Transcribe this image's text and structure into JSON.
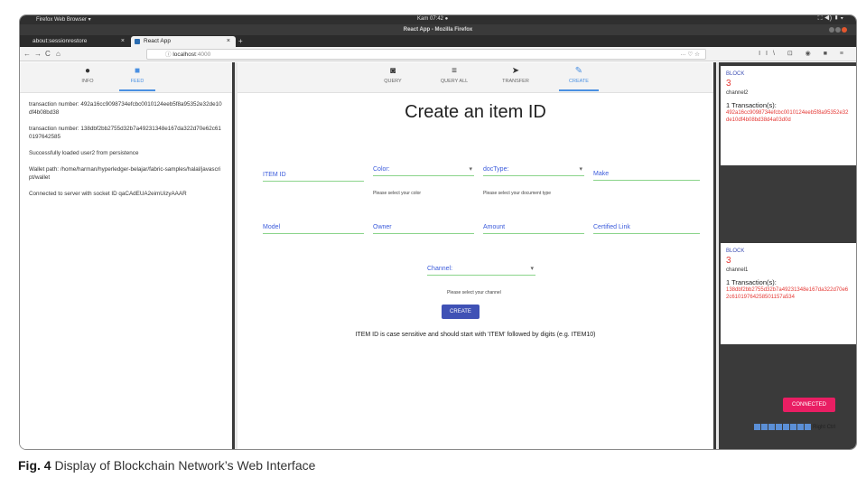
{
  "os": {
    "app_menu": "Firefox Web Browser ▾",
    "clock": "Kam 07:42 ●",
    "tray": "⛶ ◀) ▮ ▾"
  },
  "window": {
    "title": "React App - Mozilla Firefox"
  },
  "tabs": [
    {
      "label": "about:sessionrestore",
      "close": "×"
    },
    {
      "label": "React App",
      "close": "×"
    }
  ],
  "new_tab": "+",
  "nav": {
    "back": "←",
    "forward": "→",
    "reload": "C",
    "home": "⌂",
    "url_host": "localhost",
    "url_port": ":4000",
    "url_prefix": "ⓘ",
    "page_actions": "··· ♡ ☆",
    "toolbar_icons": "II\\ ⊡ ◉ ■ ≡"
  },
  "left_tabs": [
    {
      "label": "INFO",
      "icon": "info-icon",
      "glyph": "●"
    },
    {
      "label": "FEED",
      "icon": "feed-icon",
      "glyph": "■"
    }
  ],
  "feed": [
    "transaction number: 492a16cc9098734efcbc0010124eeb5f8a95352e32de10df4b08bd38",
    "transaction number: 138dbf2bb2755d32b7a49231348e167da322d70e62c610197642585",
    "Successfully loaded user2 from persistence",
    "Wallet path: /home/harman/hyperledger-belajar/fabric-samples/halal/javascript/wallet",
    "Connected to server with socket ID qaCAdEUA2eimUizyAAAR"
  ],
  "main_tabs": [
    {
      "label": "QUERY",
      "icon": "query-icon",
      "glyph": "◙"
    },
    {
      "label": "QUERY ALL",
      "icon": "list-icon",
      "glyph": "≡"
    },
    {
      "label": "TRANSFER",
      "icon": "send-icon",
      "glyph": "➤"
    },
    {
      "label": "CREATE",
      "icon": "pencil-icon",
      "glyph": "✎"
    }
  ],
  "form": {
    "title": "Create an item ID",
    "item_id": "ITEM ID",
    "color": "Color:",
    "color_hint": "Please select your color",
    "doctype": "docType:",
    "doctype_hint": "Please select your document type",
    "make": "Make",
    "model": "Model",
    "owner": "Owner",
    "amount": "Amount",
    "certified_link": "Certified Link",
    "channel": "Channel:",
    "channel_hint": "Please select your channel",
    "create_button": "CREATE",
    "note": "ITEM ID is case sensitive and should start with 'ITEM' followed by digits (e.g. ITEM10)"
  },
  "blocks": [
    {
      "label": "BLOCK",
      "number": "3",
      "channel": "channel2",
      "tx_count": "1 Transaction(s):",
      "tx_hash": "492a16cc9098734efcbc0010124eeb5f8a95352e32de10df4b08bd38d4a03d0d"
    },
    {
      "label": "BLOCK",
      "number": "3",
      "channel": "channel1",
      "tx_count": "1 Transaction(s):",
      "tx_hash": "138dbf2bb2755d32b7a49231348e167da322d70e62c6101976425850​1157a534"
    }
  ],
  "status": {
    "connected": "CONNECTED"
  },
  "taskbar": {
    "right_ctrl": "Right Ctrl"
  },
  "caption": {
    "fig": "Fig. 4",
    "text": "Display of Blockchain Network’s Web Interface"
  },
  "colors": {
    "accent": "#4a90e2",
    "button": "#3f51b5",
    "connected": "#e91e63",
    "hash": "#e53935",
    "underline": "#8bd48b"
  }
}
